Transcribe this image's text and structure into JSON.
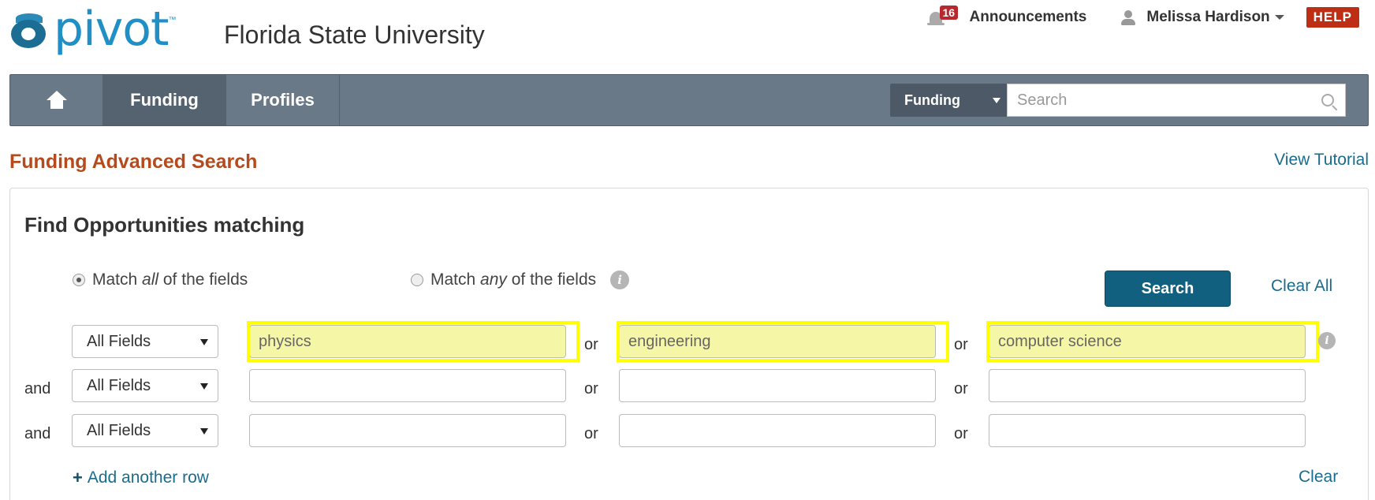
{
  "brand": {
    "logo_text": "pivot",
    "trademark": "™",
    "institution": "Florida State University"
  },
  "topnav": {
    "notification_count": "16",
    "announcements_label": "Announcements",
    "user_name": "Melissa Hardison",
    "help_label": "HELP"
  },
  "navbar": {
    "items": [
      {
        "label": "Funding",
        "active": true
      },
      {
        "label": "Profiles",
        "active": false
      }
    ],
    "search_scope": "Funding",
    "search_placeholder": "Search"
  },
  "page": {
    "title": "Funding Advanced Search",
    "tutorial_link": "View Tutorial"
  },
  "panel": {
    "title": "Find Opportunities matching",
    "match_all": {
      "pre": "Match ",
      "em": "all",
      "post": " of the fields",
      "selected": true
    },
    "match_any": {
      "pre": "Match ",
      "em": "any",
      "post": " of the fields",
      "selected": false
    },
    "info_glyph": "i",
    "search_button": "Search",
    "clear_all": "Clear All",
    "rows": [
      {
        "connector": "",
        "field": "All Fields",
        "terms": [
          "physics",
          "engineering",
          "computer science"
        ],
        "highlighted": true
      },
      {
        "connector": "and",
        "field": "All Fields",
        "terms": [
          "",
          "",
          ""
        ],
        "highlighted": false
      },
      {
        "connector": "and",
        "field": "All Fields",
        "terms": [
          "",
          "",
          ""
        ],
        "highlighted": false
      }
    ],
    "or_label": "or",
    "add_row": "Add another row",
    "add_row_glyph": "+",
    "clear": "Clear"
  }
}
